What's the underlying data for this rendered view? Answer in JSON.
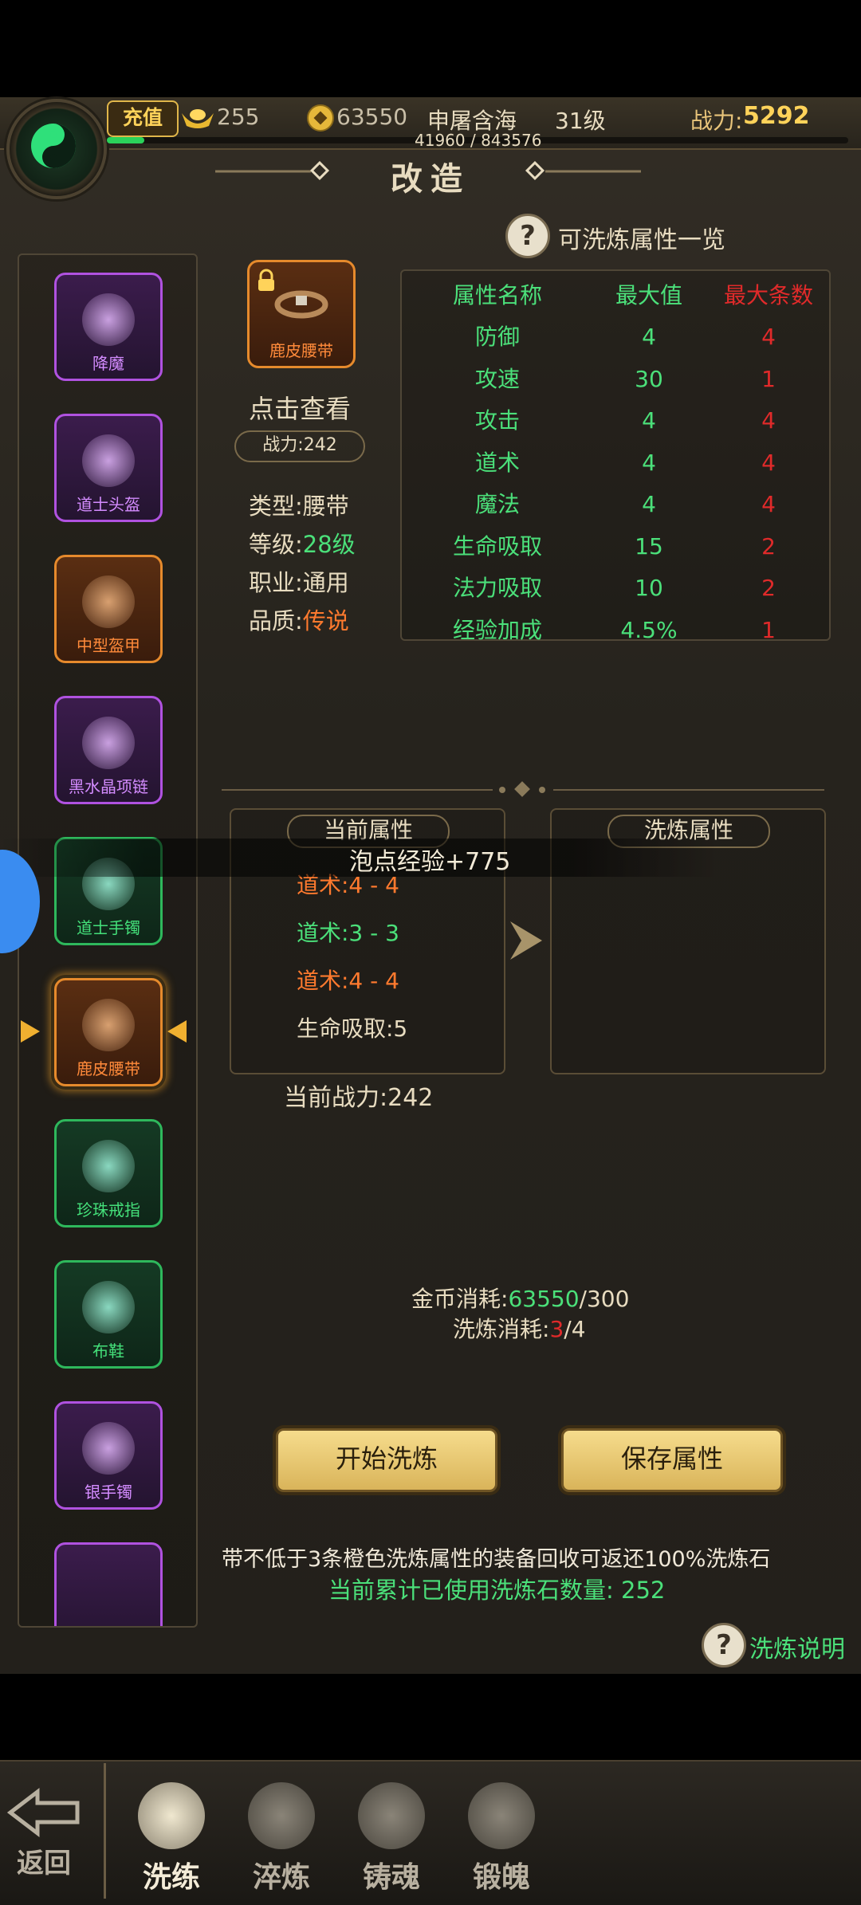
{
  "topbar": {
    "recharge_label": "充值",
    "ingot_value": "255",
    "gold_value": "63550",
    "player_name": "申屠含海",
    "level": "31级",
    "exp_text": "41960 / 843576",
    "exp_progress": 0.05,
    "power_label": "战力:",
    "power_value": "5292"
  },
  "page_title": "改造",
  "attr_list_link": "可洗炼属性一览",
  "equipment_list": [
    {
      "name": "降魔",
      "rarity": "purple"
    },
    {
      "name": "道士头盔",
      "rarity": "purple"
    },
    {
      "name": "中型盔甲",
      "rarity": "orange"
    },
    {
      "name": "黑水晶项链",
      "rarity": "purple"
    },
    {
      "name": "道士手镯",
      "rarity": "green"
    },
    {
      "name": "鹿皮腰带",
      "rarity": "orange",
      "selected": true,
      "locked": true
    },
    {
      "name": "珍珠戒指",
      "rarity": "green"
    },
    {
      "name": "布鞋",
      "rarity": "green"
    },
    {
      "name": "银手镯",
      "rarity": "purple"
    }
  ],
  "item": {
    "name": "鹿皮腰带",
    "click_view": "点击查看",
    "power": "战力:242",
    "type_label": "类型:",
    "type_value": "腰带",
    "level_label": "等级:",
    "level_value": "28级",
    "class_label": "职业:",
    "class_value": "通用",
    "quality_label": "品质:",
    "quality_value": "传说"
  },
  "attr_table": {
    "headers": [
      "属性名称",
      "最大值",
      "最大条数"
    ],
    "rows": [
      [
        "防御",
        "4",
        "4"
      ],
      [
        "攻速",
        "30",
        "1"
      ],
      [
        "攻击",
        "4",
        "4"
      ],
      [
        "道术",
        "4",
        "4"
      ],
      [
        "魔法",
        "4",
        "4"
      ],
      [
        "生命吸取",
        "15",
        "2"
      ],
      [
        "法力吸取",
        "10",
        "2"
      ],
      [
        "经验加成",
        "4.5%",
        "1"
      ]
    ]
  },
  "current_attrs": {
    "title": "当前属性",
    "lines": [
      {
        "text": "道术:4 - 4",
        "color": "#ff7a2e"
      },
      {
        "text": "道术:3 - 3",
        "color": "#4be07a"
      },
      {
        "text": "道术:4 - 4",
        "color": "#ff7a2e"
      },
      {
        "text": "生命吸取:5",
        "color": "#e8dcc0"
      }
    ],
    "power": "当前战力:242"
  },
  "refine_attrs": {
    "title": "洗炼属性"
  },
  "toast": "泡点经验+775",
  "costs": {
    "gold_label": "金币消耗:",
    "gold_have": "63550",
    "gold_need": "/300",
    "stone_label": "洗炼消耗:",
    "stone_have": "3",
    "stone_need": "/4"
  },
  "buttons": {
    "start": "开始洗炼",
    "save": "保存属性"
  },
  "notice": "带不低于3条橙色洗炼属性的装备回收可返还100%洗炼石",
  "stone_used": "当前累计已使用洗炼石数量:  252",
  "refine_help": "洗炼说明",
  "bottom_nav": {
    "back": "返回",
    "tabs": [
      "洗练",
      "淬炼",
      "铸魂",
      "锻魄"
    ]
  },
  "colors": {
    "green": "#4be07a",
    "orange": "#ff7a2e",
    "red": "#e02a2a",
    "gold": "#ffd35a"
  }
}
